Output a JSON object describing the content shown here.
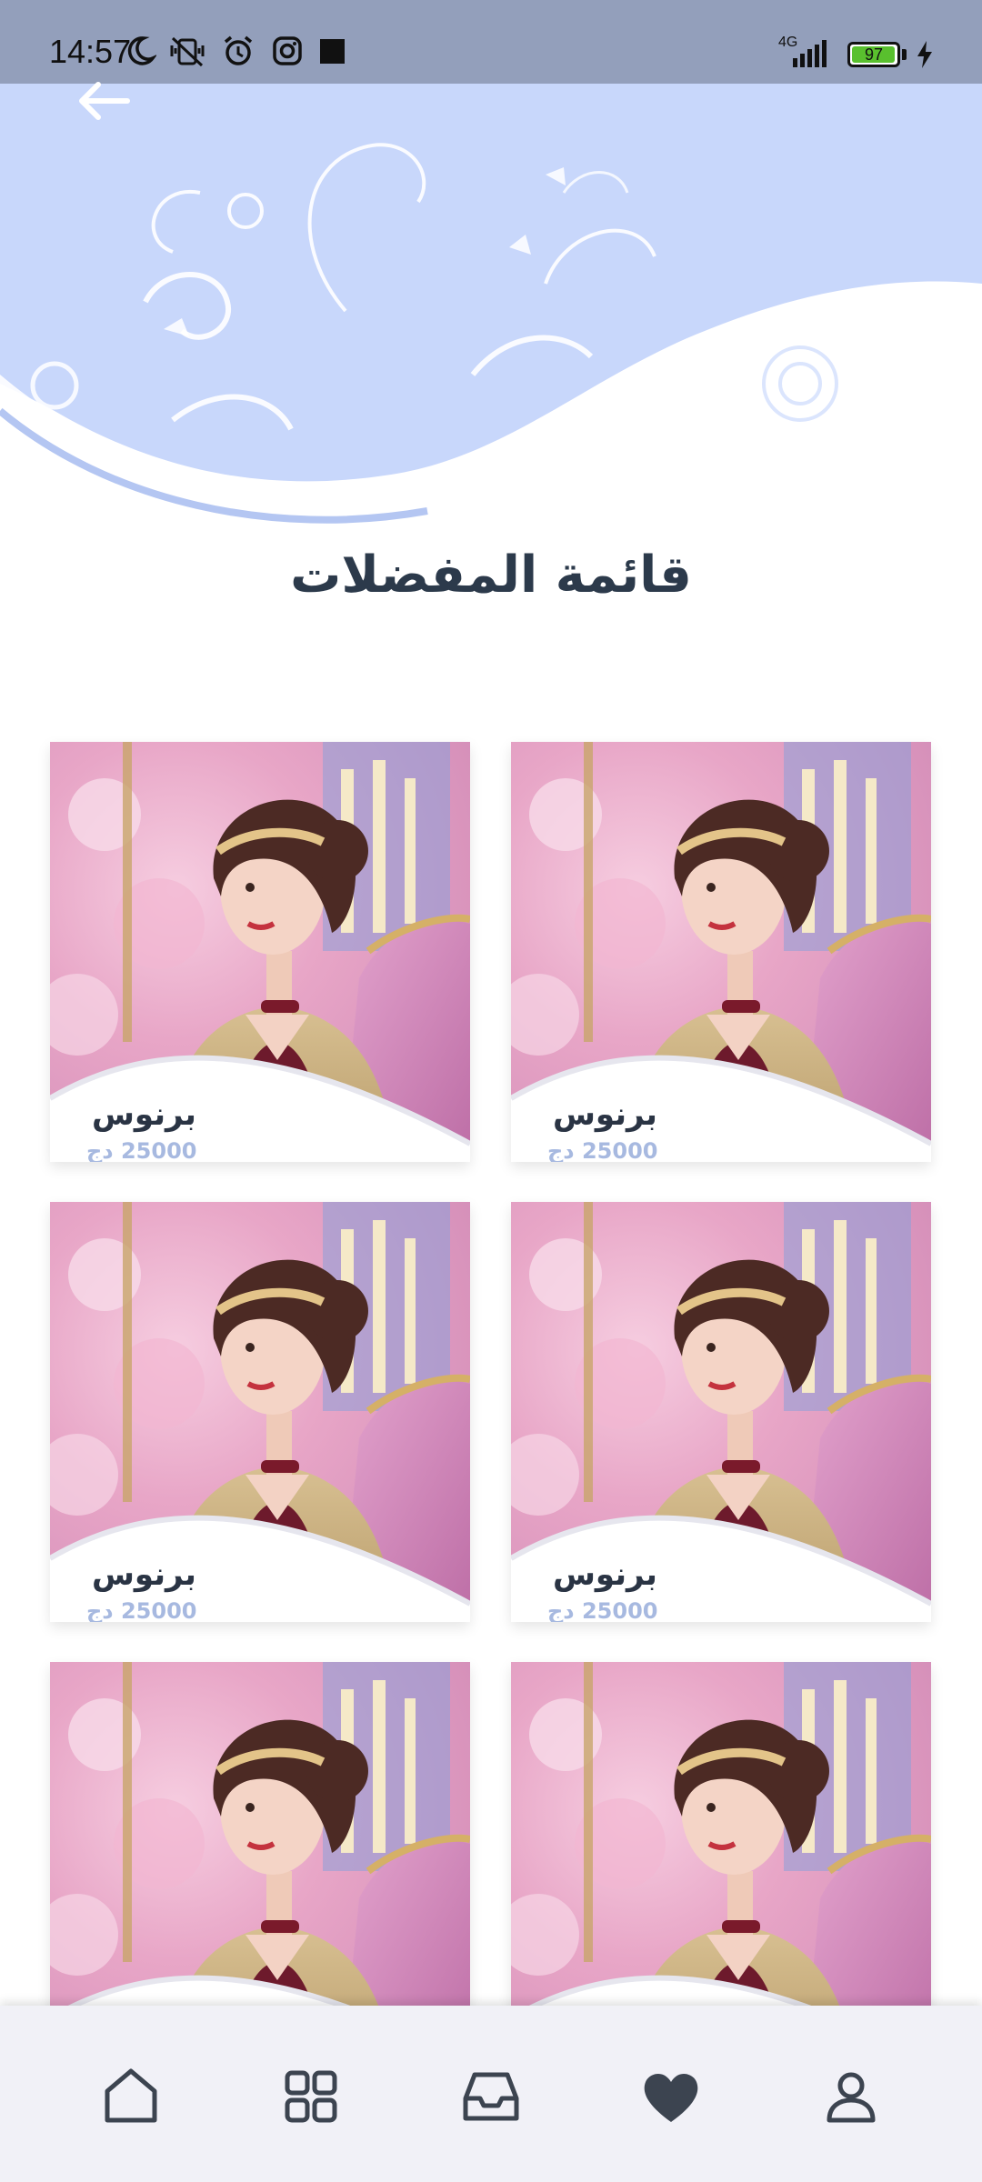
{
  "status_bar": {
    "time": "14:57",
    "network": "4G",
    "battery_percent": "97",
    "battery_level": 0.97,
    "icons": [
      "moon-icon",
      "vibrate-off-icon",
      "alarm-icon",
      "instagram-icon",
      "square-icon",
      "signal-icon",
      "battery-icon",
      "charging-icon"
    ]
  },
  "header": {
    "back_icon": "arrow-left-icon",
    "title": "قائمة المفضلات"
  },
  "colors": {
    "status_bar": "#939fbb",
    "header_bg": "#c8d7fb",
    "title": "#2c3a4b",
    "price": "#a7b9e0",
    "nav_bg": "#f1f1f7"
  },
  "favorites": [
    {
      "title": "برنوس",
      "price": "25000 دج"
    },
    {
      "title": "برنوس",
      "price": "25000 دج"
    },
    {
      "title": "برنوس",
      "price": "25000 دج"
    },
    {
      "title": "برنوس",
      "price": "25000 دج"
    },
    {
      "title": "",
      "price": ""
    },
    {
      "title": "",
      "price": ""
    }
  ],
  "bottom_nav": {
    "items": [
      "home-icon",
      "grid-icon",
      "inbox-icon",
      "heart-icon",
      "profile-icon"
    ],
    "active": "heart-icon"
  }
}
